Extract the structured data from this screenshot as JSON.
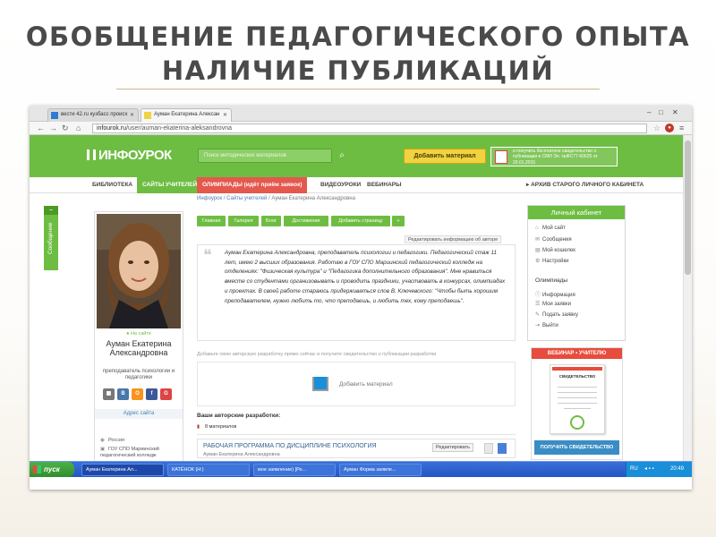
{
  "slide": {
    "title_line1": "ОБОБЩЕНИЕ ПЕДАГОГИЧЕСКОГО ОПЫТА",
    "title_line2": "НАЛИЧИЕ ПУБЛИКАЦИЙ"
  },
  "browser": {
    "tabs": [
      {
        "label": "вести 42.ru кузбасс происх",
        "active": false
      },
      {
        "label": "Ауман Екатерина Алексан",
        "active": true
      }
    ],
    "url_domain": "infourok.ru",
    "url_path": "/user/auman-ekaterina-aleksandrovna"
  },
  "site": {
    "logo": "ИНФОУРОК",
    "search_placeholder": "Поиск методических материалов",
    "add_material": "Добавить материал",
    "cert_promo": "и получить бесплатное свидетельство о публикации в СМИ Эл. №ФС77-60625 от 20.01.2015",
    "menu": [
      "БИБЛИОТЕКА",
      "САЙТЫ УЧИТЕЛЕЙ",
      "ОЛИМПИАДЫ (идёт приём заявок)",
      "ВИДЕОУРОКИ",
      "ВЕБИНАРЫ"
    ],
    "archive_link": "▸ АРХИВ СТАРОГО ЛИЧНОГО КАБИНЕТА",
    "breadcrumb": {
      "home": "Инфоурок",
      "section": "Сайты учителей",
      "current": "Ауман Екатерина Александровна"
    }
  },
  "sidebar_tab": "Сообщение",
  "profile": {
    "status": "На сайте",
    "name": "Ауман Екатерина Александровна",
    "role": "преподаватель психологии и педагогики",
    "site_address": "Адрес сайта",
    "country": "Россия",
    "org": "ГОУ СПО Мариинский педагогический колледж"
  },
  "profile_tabs": [
    "Главная",
    "Галерея",
    "Блог",
    "Достижения",
    "Добавить страницу",
    "+"
  ],
  "edit_info": "Редактировать информацию об авторе",
  "bio": "Ауман Екатерина Александровна, преподаватель психологии и педагогики. Педагогический стаж 11 лет, имею 2 высших образования. Работаю в ГОУ СПО Мариинский педагогический колледж на отделениях: \"Физическая культура\" и \"Педагогика дополнительного образования\". Мне нравиться вместе со студентами организовывать и проводить праздники, участвовать в конкурсах, олимпиадах и проектах. В своей работе стараюсь придерживаться слов В. Ключевского: \"Чтобы быть хорошим преподавателем, нужно любить то, что преподаешь, и любить тех, кому преподаешь\".",
  "invite": "Добавьте свою авторскую разработку прямо сейчас и получите свидетельство о публикации разработки",
  "upload_label": "Добавить материал",
  "developments": {
    "heading": "Ваши авторские разработки:",
    "count": "8 материалов",
    "item_title": "РАБОЧАЯ ПРОГРАММА ПО ДИСЦИПЛИНЕ ПСИХОЛОГИЯ",
    "item_author": "Ауман Екатерина Александровна",
    "edit": "Редактировать"
  },
  "cabinet": {
    "heading": "Личный кабинет",
    "items": [
      "Мой сайт",
      "Сообщения",
      "Мой кошелек",
      "Настройки"
    ],
    "olymp_heading": "Олимпиады",
    "olymp_items": [
      "Информация",
      "Мои заявки",
      "Подать заявку",
      "Выйти"
    ]
  },
  "webinar": {
    "heading": "ВЕБИНАР • УЧИТЕЛЮ",
    "cert_title": "СВИДЕТЕЛЬСТВО",
    "button": "ПОЛУЧИТЬ СВИДЕТЕЛЬСТВО"
  },
  "taskbar": {
    "start": "пуск",
    "tasks": [
      "Ауман Екатерина Ал...",
      "КАТЁНОК (Н:)",
      "мое заявление) [Ре...",
      "Ауман Форма заявле..."
    ],
    "lang": "RU",
    "time": "20:49"
  },
  "colors": {
    "brand_green": "#6ebd43",
    "accent_yellow": "#f1d341",
    "olymp_red": "#e4584d"
  }
}
